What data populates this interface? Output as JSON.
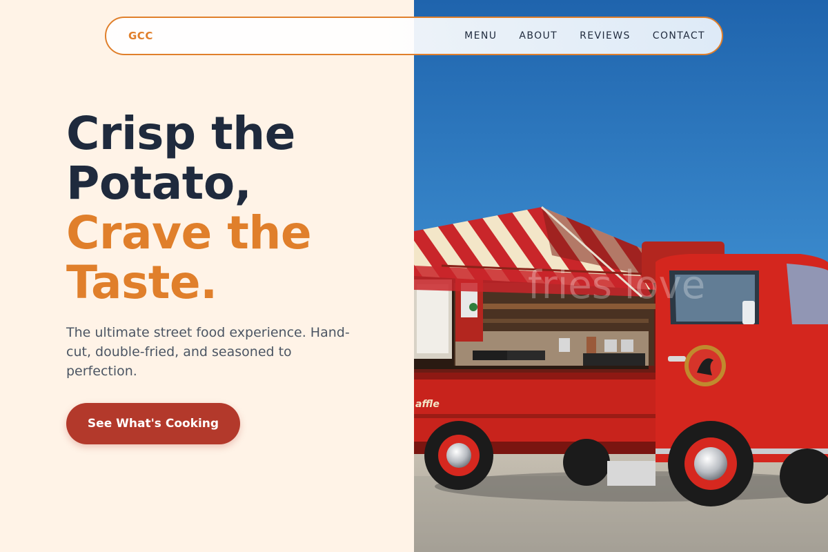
{
  "brand": {
    "logo": "GCC",
    "accent_color": "#e07f2b",
    "dark_color": "#1f2a3d",
    "button_color": "#b3392b"
  },
  "nav": {
    "items": [
      {
        "label": "MENU"
      },
      {
        "label": "ABOUT"
      },
      {
        "label": "REVIEWS"
      },
      {
        "label": "CONTACT"
      }
    ]
  },
  "hero": {
    "title_lines": [
      "Crisp the",
      "Potato,"
    ],
    "accent_lines": [
      "Crave the",
      "Taste."
    ],
    "subtitle": "The ultimate street food experience. Hand-cut, double-fried, and seasoned to perfection.",
    "cta_label": "See What's Cooking"
  },
  "image": {
    "description": "food-truck-photo",
    "truck_sign": "fries love",
    "side_text": "affle"
  }
}
